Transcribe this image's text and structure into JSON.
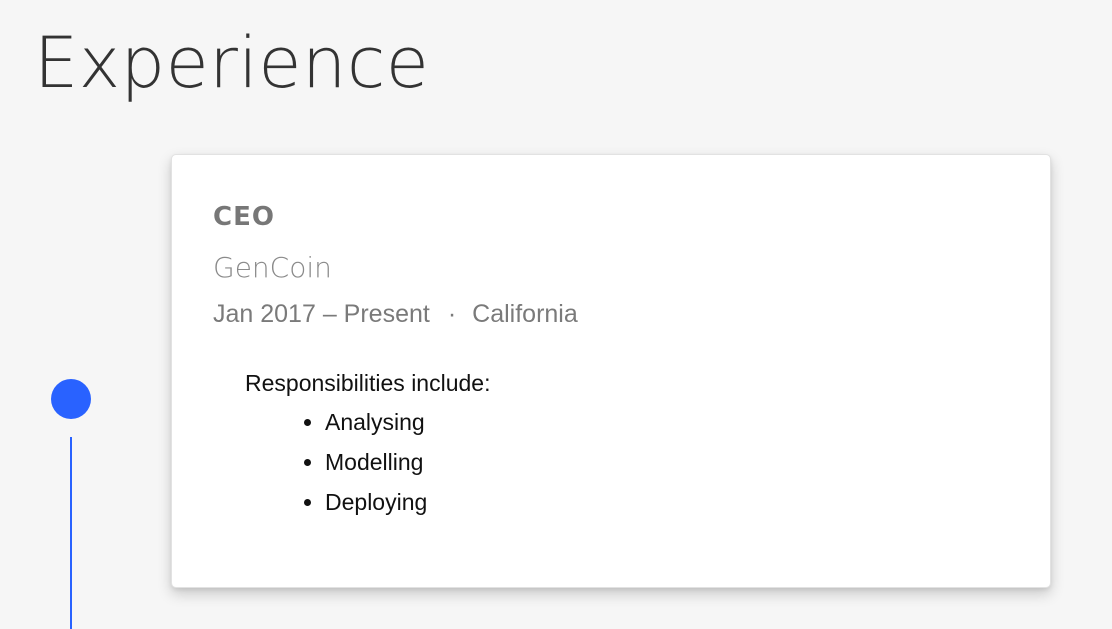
{
  "section": {
    "title": "Experience"
  },
  "timeline": {
    "color": "#2962ff"
  },
  "job": {
    "title": "CEO",
    "company": "GenCoin",
    "dates": "Jan 2017 – Present",
    "separator": "·",
    "location": "California",
    "intro": "Responsibilities include:",
    "responsibilities": [
      "Analysing",
      "Modelling",
      "Deploying"
    ]
  }
}
